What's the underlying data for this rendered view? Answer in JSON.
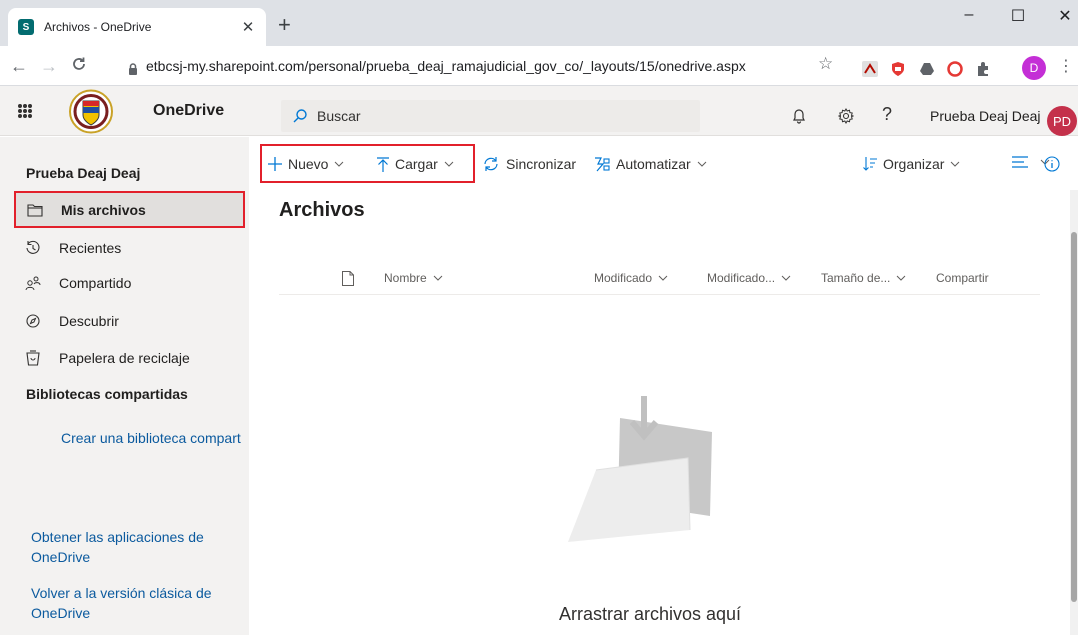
{
  "browser": {
    "tab_title": "Archivos - OneDrive",
    "favicon_letter": "S",
    "tab_close": "✕",
    "new_tab": "+",
    "url": "etbcsj-my.sharepoint.com/personal/prueba_deaj_ramajudicial_gov_co/_layouts/15/onedrive.aspx",
    "profile_initial": "D",
    "window_controls": [
      "–",
      "☐",
      "✕"
    ]
  },
  "header": {
    "app_name": "OneDrive",
    "search_placeholder": "Buscar",
    "user_name": "Prueba Deaj Deaj",
    "avatar_initials": "PD",
    "help_glyph": "?"
  },
  "sidebar": {
    "user": "Prueba Deaj Deaj",
    "items": [
      {
        "label": "Mis archivos",
        "icon": "folder-icon"
      },
      {
        "label": "Recientes",
        "icon": "history-icon"
      },
      {
        "label": "Compartido",
        "icon": "people-icon"
      },
      {
        "label": "Descubrir",
        "icon": "compass-icon"
      },
      {
        "label": "Papelera de reciclaje",
        "icon": "recycle-bin-icon"
      }
    ],
    "section_title": "Bibliotecas compartidas",
    "create_library": "Crear una biblioteca compart",
    "get_apps": "Obtener las aplicaciones de OneDrive",
    "classic": "Volver a la versión clásica de OneDrive"
  },
  "commands": {
    "new": "Nuevo",
    "upload": "Cargar",
    "sync": "Sincronizar",
    "automate": "Automatizar",
    "sort": "Organizar"
  },
  "main": {
    "title": "Archivos",
    "columns": [
      "Nombre",
      "Modificado",
      "Modificado...",
      "Tamaño de...",
      "Compartir"
    ],
    "empty_message": "Arrastrar archivos aquí"
  },
  "colors": {
    "highlight": "#e2202b",
    "avatar": "#c4314b",
    "link": "#0b5a9e",
    "nav_bg": "#f3f2f1"
  }
}
